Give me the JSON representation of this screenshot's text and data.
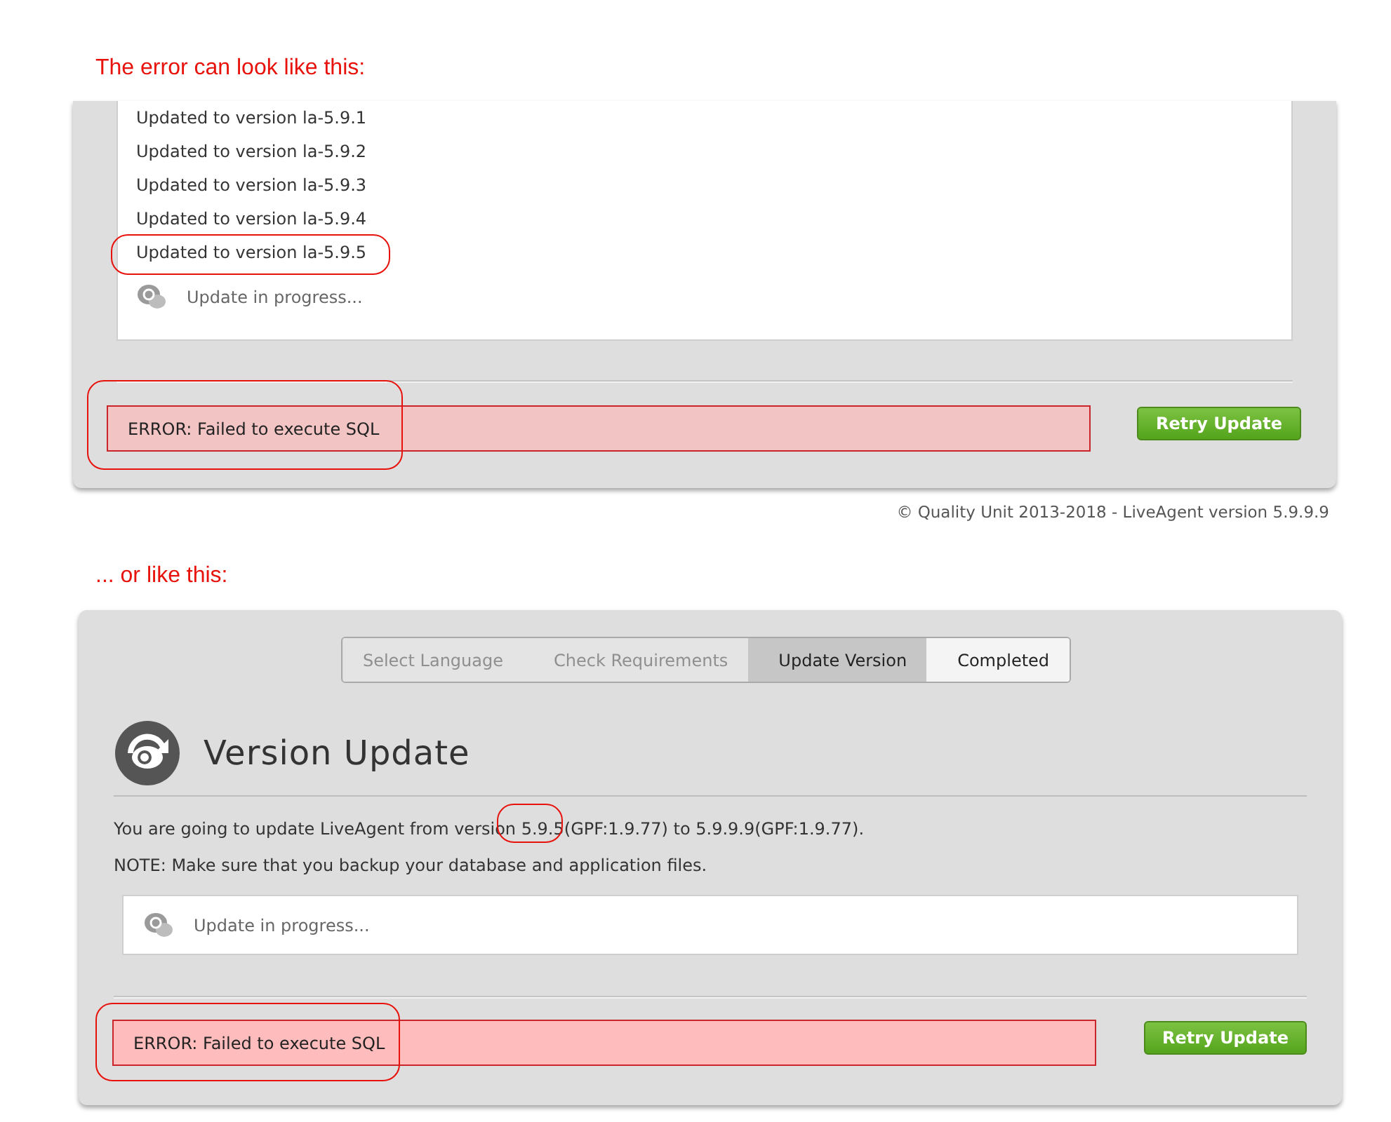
{
  "example_1": {
    "caption": "The error can look like this:",
    "log": [
      "Updated to version la-5.9.1",
      "Updated to version la-5.9.2",
      "Updated to version la-5.9.3",
      "Updated to version la-5.9.4",
      "Updated to version la-5.9.5"
    ],
    "progress": "Update in progress...",
    "error": "ERROR: Failed to execute SQL",
    "button": "Retry Update",
    "footer": "© Quality Unit 2013-2018 - LiveAgent version 5.9.9.9"
  },
  "example_2": {
    "caption": "... or like this:",
    "steps": [
      {
        "label": "Select Language",
        "selected": false,
        "done": true
      },
      {
        "label": "Check Requirements",
        "selected": false,
        "done": true
      },
      {
        "label": "Update Version",
        "selected": true,
        "done": false
      },
      {
        "label": "Completed",
        "selected": false,
        "done": false
      }
    ],
    "title": "Version Update",
    "intro": "You are going to update LiveAgent from version 5.9.5(GPF:1.9.77) to 5.9.9.9(GPF:1.9.77).",
    "note": "NOTE: Make sure that you backup your database and application files.",
    "progress": "Update in progress...",
    "error": "ERROR: Failed to execute SQL",
    "button": "Retry Update"
  }
}
